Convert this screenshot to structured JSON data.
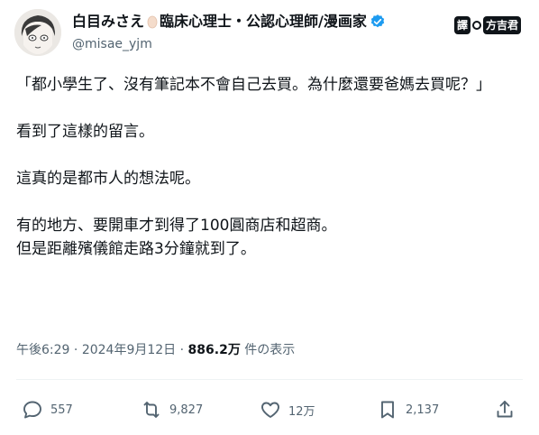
{
  "author": {
    "display_name": "白目みさえ",
    "title": "臨床心理士・公認心理師/漫画家",
    "handle": "@misae_yjm",
    "verified": true,
    "verified_color": "#1d9bf0"
  },
  "translator_badge": {
    "left_text": "譯",
    "right_text": "方吉君"
  },
  "tweet": {
    "paragraphs": [
      "「都小學生了、沒有筆記本不會自己去買。為什麼還要爸媽去買呢？」",
      "看到了這樣的留言。",
      "這真的是都市人的想法呢。",
      "有的地方、要開車才到得了100圓商店和超商。\n但是距離殯儀館走路3分鐘就到了。"
    ]
  },
  "meta": {
    "time": "午後6:29",
    "separator": "·",
    "date": "2024年9月12日",
    "views": "886.2万",
    "views_label": "件の表示"
  },
  "actions": {
    "reply_count": "557",
    "repost_count": "9,827",
    "like_count": "12万",
    "bookmark_count": "2,137",
    "reply_icon": "reply-icon",
    "repost_icon": "repost-icon",
    "like_icon": "heart-icon",
    "bookmark_icon": "bookmark-icon",
    "share_icon": "share-icon"
  }
}
